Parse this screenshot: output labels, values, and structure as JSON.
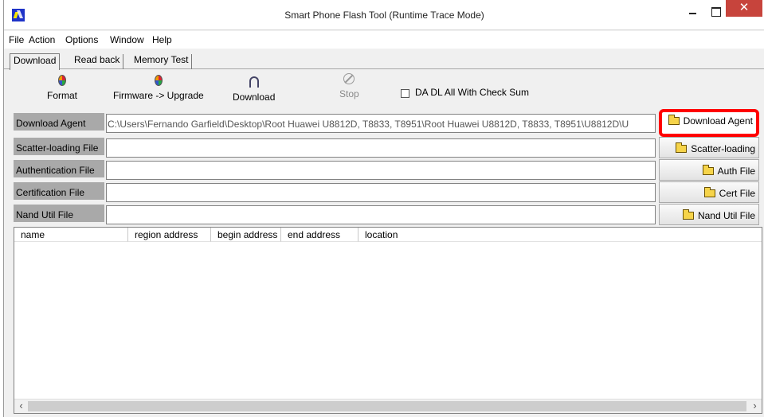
{
  "window": {
    "title": "Smart Phone Flash Tool (Runtime Trace Mode)",
    "close_label": "✕"
  },
  "menu": [
    "File",
    "Action",
    "Options",
    "Window",
    "Help"
  ],
  "tabs": [
    "Download",
    "Read back",
    "Memory Test"
  ],
  "toolbar": {
    "format": "Format",
    "firmware_upgrade": "Firmware -> Upgrade",
    "download": "Download",
    "stop": "Stop",
    "checksum_label": "DA DL All With Check Sum"
  },
  "files": [
    {
      "label": "Download Agent",
      "value": "C:\\Users\\Fernando Garfield\\Desktop\\Root Huawei U8812D, T8833, T8951\\Root Huawei U8812D, T8833, T8951\\U8812D\\U",
      "button": "Download Agent"
    },
    {
      "label": "Scatter-loading File",
      "value": "",
      "button": "Scatter-loading"
    },
    {
      "label": "Authentication File",
      "value": "",
      "button": "Auth File"
    },
    {
      "label": "Certification File",
      "value": "",
      "button": "Cert File"
    },
    {
      "label": "Nand Util File",
      "value": "",
      "button": "Nand Util File"
    }
  ],
  "table": {
    "columns": [
      "name",
      "region address",
      "begin address",
      "end address",
      "location"
    ],
    "rows": []
  },
  "scrollbar": {
    "left": "‹",
    "right": "›"
  },
  "colors": {
    "highlight": "#ff0000",
    "close": "#c7443c",
    "label_bg": "#a9a9a9"
  }
}
